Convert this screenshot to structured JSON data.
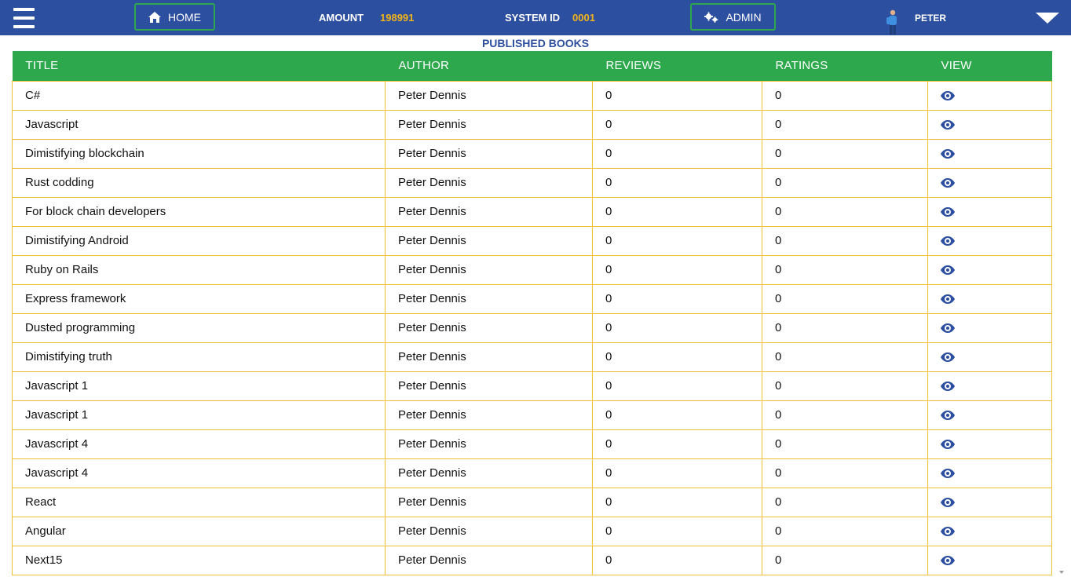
{
  "header": {
    "home_label": "HOME",
    "admin_label": "ADMIN",
    "amount_label": "AMOUNT",
    "amount_value": "198991",
    "system_id_label": "SYSTEM ID",
    "system_id_value": "0001",
    "user_name": "PETER",
    "icons": {
      "menu": "hamburger-menu-icon",
      "home": "home-icon",
      "admin": "gears-icon",
      "user": "avatar",
      "dropdown": "caret-down-icon"
    }
  },
  "page": {
    "title": "PUBLISHED BOOKS"
  },
  "table": {
    "columns": [
      "TITLE",
      "AUTHOR",
      "REVIEWS",
      "RATINGS",
      "VIEW"
    ],
    "rows": [
      {
        "title": "C#",
        "author": "Peter Dennis",
        "reviews": "0",
        "ratings": "0"
      },
      {
        "title": "Javascript",
        "author": "Peter Dennis",
        "reviews": "0",
        "ratings": "0"
      },
      {
        "title": "Dimistifying blockchain",
        "author": "Peter Dennis",
        "reviews": "0",
        "ratings": "0"
      },
      {
        "title": "Rust codding",
        "author": "Peter Dennis",
        "reviews": "0",
        "ratings": "0"
      },
      {
        "title": "For block chain developers",
        "author": "Peter Dennis",
        "reviews": "0",
        "ratings": "0"
      },
      {
        "title": "Dimistifying Android",
        "author": "Peter Dennis",
        "reviews": "0",
        "ratings": "0"
      },
      {
        "title": "Ruby on Rails",
        "author": "Peter Dennis",
        "reviews": "0",
        "ratings": "0"
      },
      {
        "title": "Express framework",
        "author": "Peter Dennis",
        "reviews": "0",
        "ratings": "0"
      },
      {
        "title": "Dusted programming",
        "author": "Peter Dennis",
        "reviews": "0",
        "ratings": "0"
      },
      {
        "title": "Dimistifying truth",
        "author": "Peter Dennis",
        "reviews": "0",
        "ratings": "0"
      },
      {
        "title": "Javascript 1",
        "author": "Peter Dennis",
        "reviews": "0",
        "ratings": "0"
      },
      {
        "title": "Javascript 1",
        "author": "Peter Dennis",
        "reviews": "0",
        "ratings": "0"
      },
      {
        "title": "Javascript 4",
        "author": "Peter Dennis",
        "reviews": "0",
        "ratings": "0"
      },
      {
        "title": "Javascript 4",
        "author": "Peter Dennis",
        "reviews": "0",
        "ratings": "0"
      },
      {
        "title": "React",
        "author": "Peter Dennis",
        "reviews": "0",
        "ratings": "0"
      },
      {
        "title": "Angular",
        "author": "Peter Dennis",
        "reviews": "0",
        "ratings": "0"
      },
      {
        "title": "Next15",
        "author": "Peter Dennis",
        "reviews": "0",
        "ratings": "0"
      }
    ],
    "view_icon": "eye-icon"
  },
  "colors": {
    "header_bg": "#2d4fa0",
    "accent_green": "#2ea84d",
    "highlight_gold": "#f2b417",
    "cell_border": "#f0c035"
  }
}
